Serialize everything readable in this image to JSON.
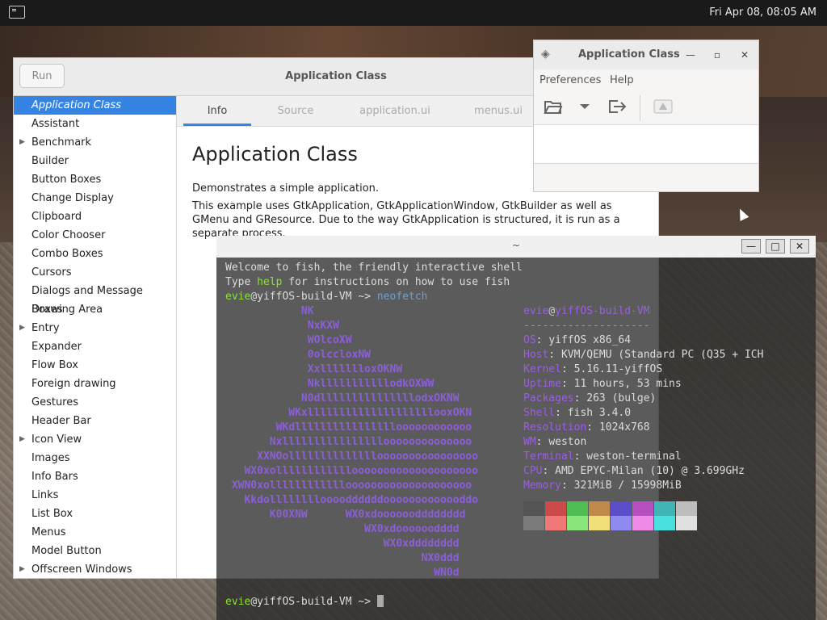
{
  "panel": {
    "clock": "Fri Apr 08, 08:05 AM"
  },
  "demo": {
    "run_label": "Run",
    "title": "Application Class",
    "tabs": [
      "Info",
      "Source",
      "application.ui",
      "menus.ui"
    ],
    "sidebar": [
      {
        "label": "Application Class",
        "selected": true,
        "expander": false
      },
      {
        "label": "Assistant",
        "expander": false
      },
      {
        "label": "Benchmark",
        "expander": true
      },
      {
        "label": "Builder",
        "expander": false
      },
      {
        "label": "Button Boxes",
        "expander": false
      },
      {
        "label": "Change Display",
        "expander": false
      },
      {
        "label": "Clipboard",
        "expander": false
      },
      {
        "label": "Color Chooser",
        "expander": false
      },
      {
        "label": "Combo Boxes",
        "expander": false
      },
      {
        "label": "Cursors",
        "expander": false
      },
      {
        "label": "Dialogs and Message Boxes",
        "expander": false
      },
      {
        "label": "Drawing Area",
        "expander": false
      },
      {
        "label": "Entry",
        "expander": true
      },
      {
        "label": "Expander",
        "expander": false
      },
      {
        "label": "Flow Box",
        "expander": false
      },
      {
        "label": "Foreign drawing",
        "expander": false
      },
      {
        "label": "Gestures",
        "expander": false
      },
      {
        "label": "Header Bar",
        "expander": false
      },
      {
        "label": "Icon View",
        "expander": true
      },
      {
        "label": "Images",
        "expander": false
      },
      {
        "label": "Info Bars",
        "expander": false
      },
      {
        "label": "Links",
        "expander": false
      },
      {
        "label": "List Box",
        "expander": false
      },
      {
        "label": "Menus",
        "expander": false
      },
      {
        "label": "Model Button",
        "expander": false
      },
      {
        "label": "Offscreen Windows",
        "expander": true
      }
    ],
    "heading": "Application Class",
    "para1": "Demonstrates a simple application.",
    "para2": "This example uses GtkApplication, GtkApplicationWindow, GtkBuilder as well as GMenu and GResource. Due to the way GtkApplication is structured, it is run as a separate process."
  },
  "app": {
    "title": "Application Class",
    "menu_preferences": "Preferences",
    "menu_help": "Help"
  },
  "terminal": {
    "title": "~",
    "welcome1": "Welcome to fish, the friendly interactive shell",
    "welcome2_a": "Type ",
    "welcome2_help": "help",
    "welcome2_b": " for instructions on how to use fish",
    "prompt_user": "evie",
    "prompt_host": "@yiffOS-build-VM",
    "prompt_path": " ~> ",
    "command": "neofetch",
    "logo": [
      "            NK",
      "             NxKXW",
      "             WOlcoXW",
      "             0olccloxNW",
      "             XxllllllloxOKNW",
      "             NklllllllllllodkOXWW",
      "            N0dlllllllllllllllodxOKNW",
      "          WKxllllllllllllllllllllooxOKN",
      "        WKdlllllllllllllllloooooooooooo",
      "       Nxlllllllllllllllloooooooooooooo",
      "     XXNOolllllllllllllloooooooooooooooo",
      "   WX0xolllllllllllloooooooooooooooooooo",
      " XWN0xolllllllllllloooooooooooooooooooo",
      "   Kkdollllllllooooddddddooooooooooooddo",
      "       K00XNW      WX0xdoooooodddddddd",
      "                      WX0xdoooooodddd",
      "                         WX0xdddddddd",
      "                               NX0ddd",
      "                                 WN0d"
    ],
    "info_user": "evie",
    "info_host": "yiffOS-build-VM",
    "info_sep": "--------------------",
    "info": [
      {
        "k": "OS",
        "v": "yiffOS x86_64"
      },
      {
        "k": "Host",
        "v": "KVM/QEMU (Standard PC (Q35 + ICH"
      },
      {
        "k": "Kernel",
        "v": "5.16.11-yiffOS"
      },
      {
        "k": "Uptime",
        "v": "11 hours, 53 mins"
      },
      {
        "k": "Packages",
        "v": "263 (bulge)"
      },
      {
        "k": "Shell",
        "v": "fish 3.4.0"
      },
      {
        "k": "Resolution",
        "v": "1024x768"
      },
      {
        "k": "WM",
        "v": "weston"
      },
      {
        "k": "Terminal",
        "v": "weston-terminal"
      },
      {
        "k": "CPU",
        "v": "AMD EPYC-Milan (10) @ 3.699GHz"
      },
      {
        "k": "Memory",
        "v": "321MiB / 15998MiB"
      }
    ],
    "palette_top": [
      "#555555",
      "#cc4a4a",
      "#4ebe54",
      "#c08a4a",
      "#5a4fc8",
      "#b74fc0",
      "#3fb6b5",
      "#bdbdbd"
    ],
    "palette_bottom": [
      "#7a7a7a",
      "#f27777",
      "#8ae67a",
      "#f0e07a",
      "#8f8af0",
      "#f08ae8",
      "#4ae0df",
      "#e0e0e0"
    ]
  }
}
